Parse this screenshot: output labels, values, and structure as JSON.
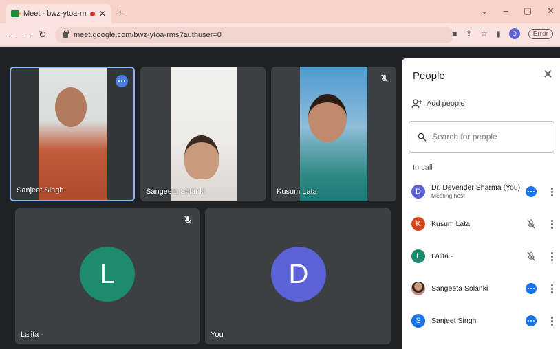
{
  "browser": {
    "tab_title": "Meet - bwz-ytoa-rms",
    "url": "meet.google.com/bwz-ytoa-rms?authuser=0",
    "profile_initial": "D",
    "error_label": "Error"
  },
  "tiles": [
    {
      "name": "Sanjeet Singh",
      "active": true
    },
    {
      "name": "Sangeeta Solanki"
    },
    {
      "name": "Kusum Lata",
      "muted": true
    },
    {
      "name": "Lalita -",
      "initial": "L",
      "color": "#1e8b6e",
      "muted": true
    },
    {
      "name": "You",
      "initial": "D",
      "color": "#5b63d6"
    }
  ],
  "panel": {
    "title": "People",
    "add_people": "Add people",
    "search_placeholder": "Search for people",
    "in_call_label": "In call",
    "participants": [
      {
        "name": "Dr. Devender Sharma (You)",
        "sub": "Meeting host",
        "initial": "D",
        "color": "#5b63d6",
        "status": "speaking"
      },
      {
        "name": "Kusum Lata",
        "initial": "K",
        "color": "#d2461e",
        "status": "muted"
      },
      {
        "name": "Lalita -",
        "initial": "L",
        "color": "#1e8b6e",
        "status": "muted"
      },
      {
        "name": "Sangeeta Solanki",
        "initial": "",
        "color": "#c98d86",
        "status": "speaking"
      },
      {
        "name": "Sanjeet Singh",
        "initial": "S",
        "color": "#1a73e8",
        "status": "speaking"
      }
    ]
  },
  "colors": {
    "stage_bg": "#202124",
    "tile_bg": "#3c4043",
    "active_border": "#8ab4f8",
    "browser_tab": "#f6d2c9"
  }
}
